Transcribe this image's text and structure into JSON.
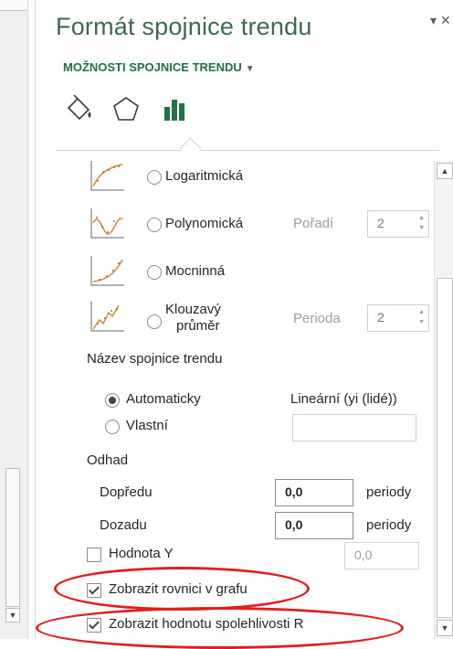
{
  "pane": {
    "title": "Formát spojnice trendu",
    "menu_arrow": "▾",
    "close_glyph": "✕",
    "options_header": "MOŽNOSTI SPOJNICE TRENDU",
    "options_caret": "▼"
  },
  "tabs": [
    {
      "name": "fill-line-tab",
      "icon": "paint-bucket-icon"
    },
    {
      "name": "effects-tab",
      "icon": "pentagon-icon"
    },
    {
      "name": "trendline-options-tab",
      "icon": "bar-chart-icon",
      "active": true
    }
  ],
  "trend_types": {
    "log": {
      "label": "Logaritmická",
      "selected": false
    },
    "poly": {
      "label": "Polynomická",
      "selected": false,
      "param_label": "Pořadí",
      "param_value": "2"
    },
    "power": {
      "label": "Mocninná",
      "selected": false
    },
    "moving": {
      "label_line1": "Klouzavý",
      "label_line2": "průměr",
      "selected": false,
      "param_label": "Perioda",
      "param_value": "2"
    }
  },
  "trend_name": {
    "section_label": "Název spojnice trendu",
    "automatic_label": "Automaticky",
    "automatic_value": "Lineární (yi (lidé))",
    "custom_label": "Vlastní",
    "custom_value": ""
  },
  "forecast": {
    "section_label": "Odhad",
    "forward_label": "Dopředu",
    "forward_value": "0,0",
    "backward_label": "Dozadu",
    "backward_value": "0,0",
    "unit": "periody"
  },
  "intercept": {
    "label": "Hodnota Y",
    "checked": false,
    "value": "0,0"
  },
  "display_equation": {
    "label": "Zobrazit rovnici v grafu",
    "checked": true
  },
  "display_rsquared": {
    "label": "Zobrazit hodnotu spolehlivosti R",
    "checked": true
  },
  "scroll": {
    "up": "▲",
    "down": "▼"
  },
  "colors": {
    "title": "#3a6d4b",
    "header": "#217346",
    "highlight": "#e11f1f",
    "active_tab": "#217346"
  }
}
